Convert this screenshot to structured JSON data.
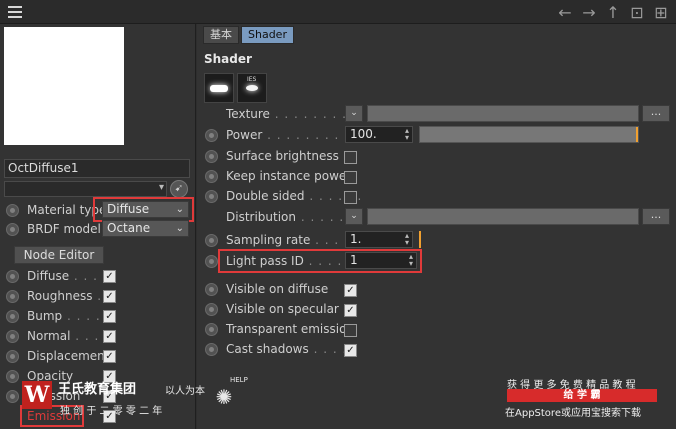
{
  "topbar": {
    "menu_icon": "hamburger-icon",
    "nav_icons": [
      "arrow-left-icon",
      "arrow-right-icon",
      "arrow-up-icon",
      "lock-icon",
      "add-window-icon"
    ]
  },
  "left": {
    "material_name": "OctDiffuse1",
    "material_type_label": "Material type",
    "material_type_value": "Diffuse",
    "brdf_label": "BRDF model",
    "brdf_value": "Octane",
    "node_editor_label": "Node Editor",
    "channels": [
      {
        "label": "Diffuse",
        "checked": true
      },
      {
        "label": "Roughness",
        "checked": true
      },
      {
        "label": "Bump",
        "checked": true
      },
      {
        "label": "Normal",
        "checked": true
      },
      {
        "label": "Displacement",
        "checked": true
      },
      {
        "label": "Opacity",
        "checked": true
      },
      {
        "label": "Emission",
        "checked": true
      }
    ],
    "emission_overlay": "Emission"
  },
  "right": {
    "tabs": [
      {
        "label": "基本",
        "active": false
      },
      {
        "label": "Shader",
        "active": true
      }
    ],
    "section_title": "Shader",
    "ies_label": "IES",
    "texture_label": "Texture",
    "power_label": "Power",
    "power_value": "100.",
    "surface_brightness_label": "Surface brightness",
    "keep_instance_power_label": "Keep instance power",
    "double_sided_label": "Double sided",
    "distribution_label": "Distribution",
    "sampling_rate_label": "Sampling rate",
    "sampling_rate_value": "1.",
    "light_pass_id_label": "Light pass ID",
    "light_pass_id_value": "1",
    "visible_on_diffuse_label": "Visible on diffuse",
    "visible_on_specular_label": "Visible on specular",
    "transparent_emission_label": "Transparent emission",
    "cast_shadows_label": "Cast shadows",
    "ellipsis": "...",
    "colors": {
      "accent_tab": "#7a9bc0",
      "highlight": "#e03a3a",
      "slider_mark": "#f0a030"
    }
  },
  "watermark": {
    "logo_letter": "W",
    "brand_name": "王氏教育集团",
    "motto": "以人为本",
    "help": "HELP",
    "sub_line": "独 创 于 二 零 零 二 年",
    "promo_line1": "获 得 更 多 免 费 精 品 教 程",
    "promo_badge": "给 学 霸",
    "promo_line2": "在AppStore或应用宝搜索下载"
  }
}
